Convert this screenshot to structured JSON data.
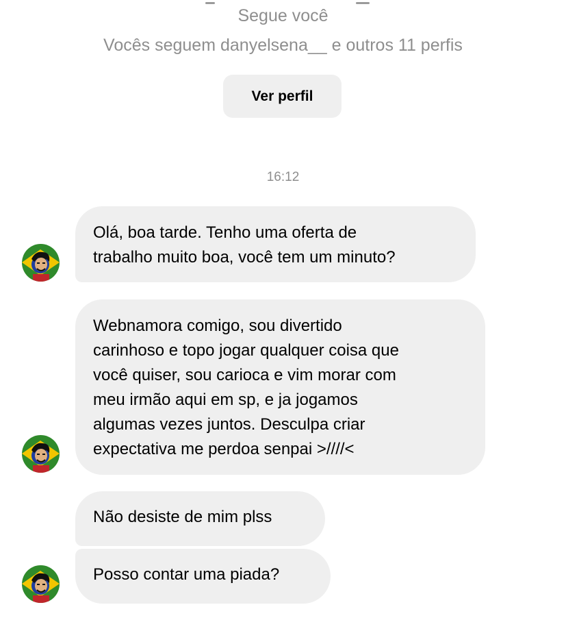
{
  "profile": {
    "follows_you": "Segue você",
    "mutuals": "Vocês seguem danyelsena__ e outros 11 perfis",
    "view_profile_label": "Ver perfil"
  },
  "timestamp": "16:12",
  "messages": [
    {
      "text": "Olá, boa tarde. Tenho uma oferta de\ntrabalho muito boa, você tem um minuto?"
    },
    {
      "text": "Webnamora comigo, sou divertido\ncarinhoso e topo jogar qualquer coisa que\nvocê quiser, sou carioca e vim morar com\nmeu irmão aqui em sp, e ja jogamos\nalgumas vezes juntos. Desculpa criar\nexpectativa me perdoa senpai >////<"
    },
    {
      "text": "Não desiste de mim plss"
    },
    {
      "text": "Posso contar uma piada?"
    }
  ],
  "colors": {
    "bubble": "#efefef",
    "secondary_text": "#8e8e8e",
    "avatar_green": "#2f8a2b",
    "avatar_yellow": "#f2c500",
    "avatar_blue": "#1f3fa0"
  }
}
